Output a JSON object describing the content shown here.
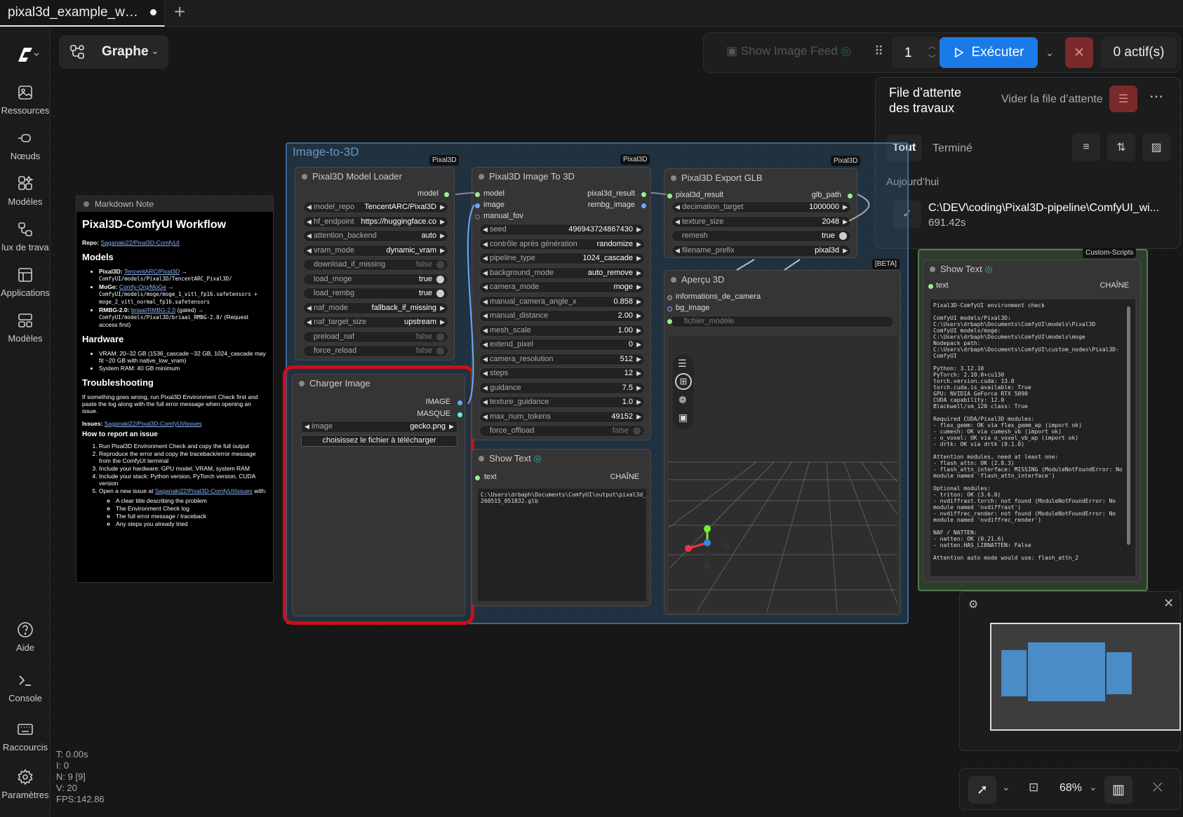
{
  "tab": {
    "title": "pixal3d_example_w…",
    "new_tab": "+"
  },
  "sidebar": {
    "items": [
      {
        "label": "Ressources",
        "icon": "images-icon"
      },
      {
        "label": "Nœuds",
        "icon": "node-icon"
      },
      {
        "label": "Modèles",
        "icon": "models-icon"
      },
      {
        "label": "lux de trava",
        "icon": "workflow-icon"
      },
      {
        "label": "Applications",
        "icon": "apps-icon"
      },
      {
        "label": "Modèles",
        "icon": "templates-icon"
      },
      {
        "label": "Aide",
        "icon": "help-icon"
      },
      {
        "label": "Console",
        "icon": "console-icon"
      },
      {
        "label": "Raccourcis",
        "icon": "keyboard-icon"
      },
      {
        "label": "Paramètres",
        "icon": "gear-icon"
      }
    ]
  },
  "graph_toggle": {
    "label": "Graphe"
  },
  "runbar": {
    "show_feed": "Show Image Feed",
    "batch_count": "1",
    "run": "Exécuter",
    "active": "0 actif(s)"
  },
  "queue": {
    "title_line1": "File d’attente",
    "title_line2": "des travaux",
    "clear": "Vider la file d’attente",
    "tab_all": "Tout",
    "tab_done": "Terminé",
    "today": "Aujourd’hui",
    "job_path": "C:\\DEV\\coding\\Pixal3D-pipeline\\ComfyUI_wi...",
    "job_time": "691.42s"
  },
  "group": {
    "title": "Image-to-3D"
  },
  "badges": {
    "pixal3d": "Pixal3D",
    "beta": "[BETA]",
    "custom_scripts": "Custom-Scripts"
  },
  "markdown": {
    "header": "Markdown Note",
    "title": "Pixal3D-ComfyUI Workflow",
    "repo_label": "Repo:",
    "repo_link": "Saganaki22/Pixal3D-ComfyUI",
    "models_h": "Models",
    "m1_name": "Pixal3D:",
    "m1_link": "TencentARC/Pixal3D",
    "m1_path": "ComfyUI/models/Pixal3D/TencentARC_Pixal3D/",
    "m2_name": "MoGe:",
    "m2_link": "Comfy-Org/MoGe",
    "m2_path": "ComfyUI/models/moge/moge_1_vitl_fp16.safetensors + moge_2_vitl_normal_fp16.safetensors",
    "m3_name": "RMBG-2.0:",
    "m3_link": "briaai/RMBG-2.0",
    "m3_gated": "(gated) →",
    "m3_path": "ComfyUI/models/Pixal3D/briaai_RMBG-2.0/",
    "m3_note": "(Request access first)",
    "hw_h": "Hardware",
    "hw1": "VRAM: 20–32 GB (1536_cascade ~32 GB, 1024_cascade may fit ~20 GB with native_low_vram)",
    "hw2": "System RAM: 40 GB minimum",
    "ts_h": "Troubleshooting",
    "ts_text": "If something goes wrong, run Pixal3D Environment Check first and paste the log along with the full error message when opening an issue.",
    "issues_label": "Issues:",
    "issues_link": "Saganaki22/Pixal3D-ComfyUI/issues",
    "report_h": "How to report an issue",
    "r1": "Run Pixal3D Environment Check and copy the full output",
    "r2": "Reproduce the error and copy the traceback/error message from the ComfyUI terminal",
    "r3": "Include your hardware: GPU model, VRAM, system RAM",
    "r4": "Include your stack: Python version, PyTorch version, CUDA version",
    "r5a": "Open a new issue at",
    "r5_link": "Saganaki22/Pixal3D-ComfyUI/issues",
    "r5b": "with:",
    "s1": "A clear title describing the problem",
    "s2": "The Environment Check log",
    "s3": "The full error message / traceback",
    "s4": "Any steps you already tried"
  },
  "loader": {
    "title": "Pixal3D Model Loader",
    "out": "model",
    "widgets": [
      {
        "name": "model_repo",
        "value": "TencentARC/Pixal3D"
      },
      {
        "name": "hf_endpoint",
        "value": "https://huggingface.co"
      },
      {
        "name": "attention_backend",
        "value": "auto"
      },
      {
        "name": "vram_mode",
        "value": "dynamic_vram"
      },
      {
        "name": "download_if_missing",
        "value": "false"
      },
      {
        "name": "load_moge",
        "value": "true"
      },
      {
        "name": "load_rembg",
        "value": "true"
      },
      {
        "name": "naf_mode",
        "value": "fallback_if_missing"
      },
      {
        "name": "naf_target_size",
        "value": "upstream"
      },
      {
        "name": "preload_naf",
        "value": "false"
      },
      {
        "name": "force_reload",
        "value": "false"
      }
    ]
  },
  "charger": {
    "title": "Charger Image",
    "out_image": "IMAGE",
    "out_mask": "MASQUE",
    "image_label": "image",
    "image_value": "gecko.png",
    "upload": "choisissez le fichier à télécharger"
  },
  "to3d": {
    "title": "Pixal3D Image To 3D",
    "in_model": "model",
    "in_image": "image",
    "in_fov": "manual_fov",
    "out_result": "pixal3d_result",
    "out_rembg": "rembg_image",
    "widgets": [
      {
        "name": "seed",
        "value": "496943724867430"
      },
      {
        "name": "contrôle après génération",
        "value": "randomize"
      },
      {
        "name": "pipeline_type",
        "value": "1024_cascade"
      },
      {
        "name": "background_mode",
        "value": "auto_remove"
      },
      {
        "name": "camera_mode",
        "value": "moge"
      },
      {
        "name": "manual_camera_angle_x",
        "value": "0.858"
      },
      {
        "name": "manual_distance",
        "value": "2.00"
      },
      {
        "name": "mesh_scale",
        "value": "1.00"
      },
      {
        "name": "extend_pixel",
        "value": "0"
      },
      {
        "name": "camera_resolution",
        "value": "512"
      },
      {
        "name": "steps",
        "value": "12"
      },
      {
        "name": "guidance",
        "value": "7.5"
      },
      {
        "name": "texture_guidance",
        "value": "1.0"
      },
      {
        "name": "max_num_tokens",
        "value": "49152"
      },
      {
        "name": "force_offload",
        "value": "false"
      }
    ]
  },
  "showtext1": {
    "title": "Show Text",
    "in": "text",
    "type": "CHAÎNE",
    "content": "C:\\Users\\drbaph\\Documents\\ComfyUI\\output\\pixal3d_20\n260515_051832.glb"
  },
  "export": {
    "title": "Pixal3D Export GLB",
    "in": "pixal3d_result",
    "out": "glb_path",
    "widgets": [
      {
        "name": "decimation_target",
        "value": "1000000"
      },
      {
        "name": "texture_size",
        "value": "2048"
      },
      {
        "name": "remesh",
        "value": "true"
      },
      {
        "name": "filename_prefix",
        "value": "pixal3d"
      }
    ]
  },
  "preview": {
    "title": "Aperçu 3D",
    "in1": "informations_de_camera",
    "in2": "bg_image",
    "in3": "fichier_modèle"
  },
  "showtext2": {
    "title": "Show Text",
    "in": "text",
    "type": "CHAÎNE",
    "content": "Pixal3D-ComfyUI environment check\n\nComfyUI models/Pixal3D:\nC:\\Users\\drbaph\\Documents\\ComfyUI\\models\\Pixal3D\nComfyUI models/moge:\nC:\\Users\\drbaph\\Documents\\ComfyUI\\models\\moge\nNodepack path:\nC:\\Users\\drbaph\\Documents\\ComfyUI\\custom_nodes\\Pixal3D-\nComfyUI\n\nPython: 3.12.10\nPyTorch: 2.10.0+cu130\ntorch.version.cuda: 13.0\ntorch.cuda.is_available: True\nGPU: NVIDIA GeForce RTX 5090\nCUDA capability: 12.0\nBlackwell/sm_120 class: True\n\nRequired CUDA/Pixal3D modules:\n- flex_gemm: OK via flex_gemm_ap (import ok)\n- cumesh: OK via cumesh_vb (import ok)\n- o_voxel: OK via o_voxel_vb_ap (import ok)\n- drtk: OK via drtk (0.1.0)\n\nAttention modules, need at least one:\n- flash_attn: OK (2.8.3)\n- flash_attn_interface: MISSING (ModuleNotFoundError: No\nmodule named 'flash_attn_interface')\n\nOptional modules:\n- triton: OK (3.6.0)\n- nvdiffrast.torch: not found (ModuleNotFoundError: No\nmodule named 'nvdiffrast')\n- nvdiffrec_render: not found (ModuleNotFoundError: No\nmodule named 'nvdiffrec_render')\n\nNAF / NATTEN:\n- natten: OK (0.21.6)\n- natten.HAS_LIBNATTEN: False\n\nAttention auto mode would use: flash_attn_2"
  },
  "zoom": {
    "level": "68%"
  },
  "stats": {
    "t": "T: 0.00s",
    "i": "I: 0",
    "n": "N: 9 [9]",
    "v": "V: 20",
    "fps": "FPS:142.86"
  },
  "colors": {
    "accent": "#1a7ae8",
    "stop": "#7a2a2a",
    "selection": "#c8101a",
    "group": "#3a6a98"
  }
}
